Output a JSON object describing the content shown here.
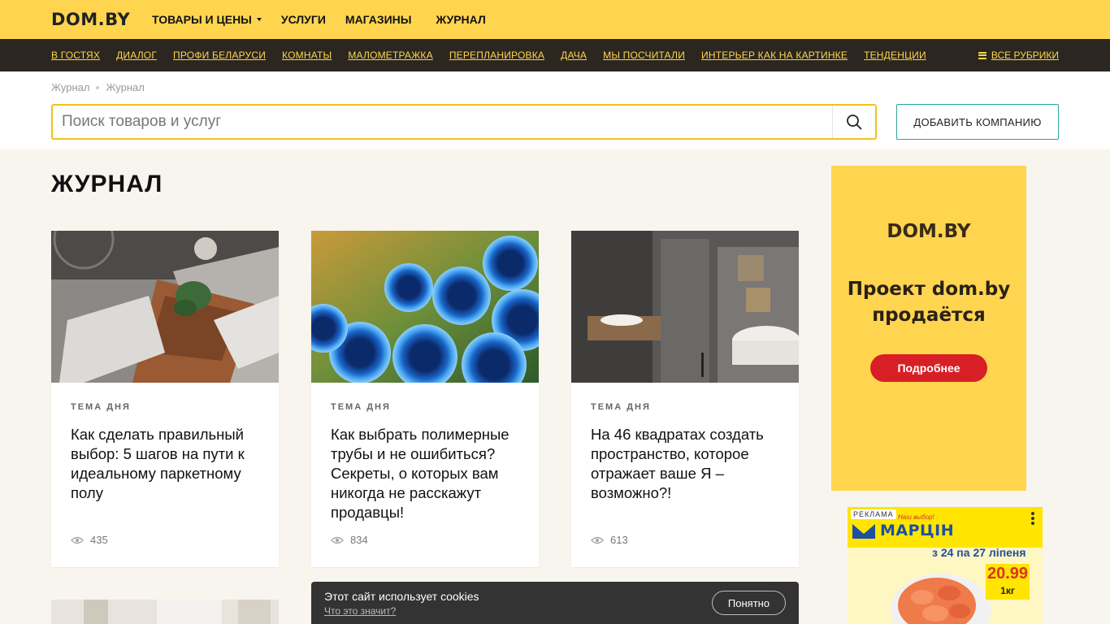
{
  "header": {
    "logo": "DOM.BY",
    "nav": [
      {
        "label": "ТОВАРЫ И ЦЕНЫ"
      },
      {
        "label": "УСЛУГИ"
      },
      {
        "label": "МАГАЗИНЫ"
      },
      {
        "label": "ЖУРНАЛ"
      }
    ]
  },
  "rubrics": {
    "items": [
      "В ГОСТЯХ",
      "ДИАЛОГ",
      "ПРОФИ БЕЛАРУСИ",
      "КОМНАТЫ",
      "МАЛОМЕТРАЖКА",
      "ПЕРЕПЛАНИРОВКА",
      "ДАЧА",
      "МЫ ПОСЧИТАЛИ",
      "ИНТЕРЬЕР КАК НА КАРТИНКЕ",
      "ТЕНДЕНЦИИ"
    ],
    "all_label": "ВСЕ РУБРИКИ"
  },
  "breadcrumb": [
    "Журнал",
    "Журнал"
  ],
  "search": {
    "placeholder": "Поиск товаров и услуг",
    "value": ""
  },
  "add_company_label": "ДОБАВИТЬ КОМПАНИЮ",
  "page_title": "ЖУРНАЛ",
  "articles": [
    {
      "kicker": "ТЕМА ДНЯ",
      "title": "Как сделать правильный выбор: 5 шагов на пути к идеальному паркетному полу",
      "views": "435"
    },
    {
      "kicker": "ТЕМА ДНЯ",
      "title": "Как выбрать полимерные трубы и не ошибиться? Секреты, о которых вам никогда не расскажут продавцы!",
      "views": "834"
    },
    {
      "kicker": "ТЕМА ДНЯ",
      "title": "На 46 квадратах создать пространство, которое отражает ваше Я – возможно?!",
      "views": "613"
    }
  ],
  "ad_top": {
    "logo": "DOM.BY",
    "text_line1": "Проект dom.by",
    "text_line2": "продаётся",
    "button": "Подробнее"
  },
  "ad_bottom": {
    "label": "РЕКЛАМА",
    "tagline": "Наш выбор!",
    "brand": "МАРЦІН",
    "dates": "з 24 па 27 ліпеня",
    "price": "20.99",
    "unit": "1кг"
  },
  "cookie": {
    "text": "Этот сайт использует cookies",
    "link": "Что это значит?",
    "button": "Понятно"
  },
  "colors": {
    "brand_yellow": "#ffd54f",
    "dark_bar": "#2b261f",
    "teal": "#2aa59a",
    "ad_red": "#d91f26"
  },
  "icons": [
    "search-icon",
    "eye-icon",
    "menu-icon",
    "chevron-down-icon",
    "kebab-icon"
  ]
}
